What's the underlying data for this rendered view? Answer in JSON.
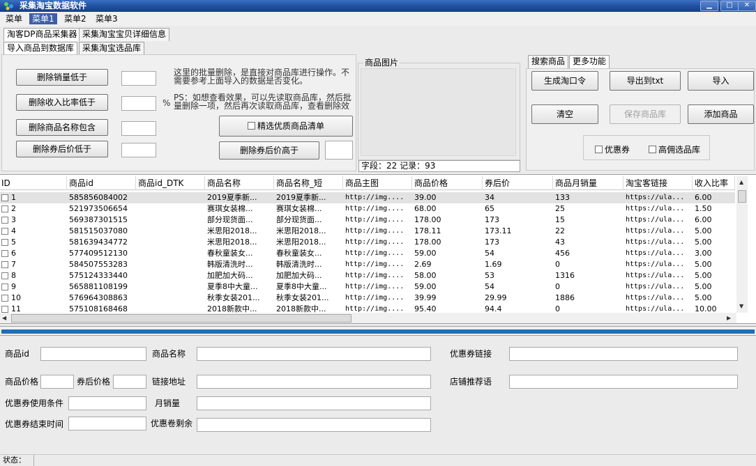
{
  "window": {
    "title": "采集淘宝数据软件"
  },
  "menubar": {
    "items": [
      "菜单",
      "菜单1",
      "菜单2",
      "菜单3"
    ],
    "active": "菜单1"
  },
  "tabs_row1": [
    "淘客DP商品采集器",
    "采集淘宝宝贝详细信息"
  ],
  "tabs_row2": [
    "导入商品到数据库",
    "采集淘宝选品库"
  ],
  "delete_panel": {
    "btn_sales_below": "删除销量低于",
    "btn_income_ratio_below": "删除收入比率低于",
    "percent_sign": "%",
    "btn_name_contains": "删除商品名称包含",
    "btn_coupon_price_below": "删除券后价低于",
    "btn_coupon_price_above": "删除券后价高于",
    "chk_quality_list": "精选优质商品清单",
    "note1": "这里的批量删除，是直接对商品库进行操作。不需要参考上面导入的数据是否变化。",
    "note2": "PS：如想查看效果，可以先读取商品库，然后批量删除一项，然后再次读取商品库，查看删除效果"
  },
  "image_group": {
    "title": "商品图片",
    "status": "字段：22 记录：93"
  },
  "right_panel": {
    "tabs": [
      "搜索商品",
      "更多功能"
    ],
    "btn_generate_token": "生成淘口令",
    "btn_export_txt": "导出到txt",
    "btn_import": "导入",
    "btn_clear": "清空",
    "btn_save": "保存商品库",
    "btn_add": "添加商品",
    "chk_coupon": "优惠券",
    "chk_high_commission": "高佣选品库"
  },
  "grid": {
    "columns": [
      "ID",
      "商品id",
      "商品id_DTK",
      "商品名称",
      "商品名称_短",
      "商品主图",
      "商品价格",
      "券后价",
      "商品月销量",
      "淘宝客链接",
      "收入比率"
    ],
    "rows": [
      [
        "1",
        "585856084002",
        "",
        "2019夏季新...",
        "2019夏季新...",
        "http://img....",
        "39.00",
        "34",
        "133",
        "https://ula...",
        "6.00"
      ],
      [
        "2",
        "521973506654",
        "",
        "赛琪女装棉...",
        "赛琪女装棉...",
        "http://img....",
        "68.00",
        "65",
        "25",
        "https://ula...",
        "1.50"
      ],
      [
        "3",
        "569387301515",
        "",
        "部分现货面...",
        "部分现货面...",
        "http://img....",
        "178.00",
        "173",
        "15",
        "https://ula...",
        "6.00"
      ],
      [
        "4",
        "581515037080",
        "",
        "米思阳2018...",
        "米思阳2018...",
        "http://img....",
        "178.11",
        "173.11",
        "22",
        "https://ula...",
        "5.00"
      ],
      [
        "5",
        "581639434772",
        "",
        "米思阳2018...",
        "米思阳2018...",
        "http://img....",
        "178.00",
        "173",
        "43",
        "https://ula...",
        "5.00"
      ],
      [
        "6",
        "577409512130",
        "",
        "春秋童装女...",
        "春秋童装女...",
        "http://img....",
        "59.00",
        "54",
        "456",
        "https://ula...",
        "3.00"
      ],
      [
        "7",
        "584507553283",
        "",
        "韩版清洗时...",
        "韩版清洗时...",
        "http://img....",
        "2.69",
        "1.69",
        "0",
        "https://ula...",
        "5.00"
      ],
      [
        "8",
        "575124333440",
        "",
        "加肥加大码...",
        "加肥加大码...",
        "http://img....",
        "58.00",
        "53",
        "1316",
        "https://ula...",
        "5.00"
      ],
      [
        "9",
        "565881108199",
        "",
        "夏季8中大童...",
        "夏季8中大童...",
        "http://img....",
        "59.00",
        "54",
        "0",
        "https://ula...",
        "5.00"
      ],
      [
        "10",
        "576964308863",
        "",
        "秋季女装201...",
        "秋季女装201...",
        "http://img....",
        "39.99",
        "29.99",
        "1886",
        "https://ula...",
        "5.00"
      ],
      [
        "11",
        "575108168468",
        "",
        "2018新款中...",
        "2018新款中...",
        "http://img....",
        "95.40",
        "94.4",
        "0",
        "https://ula...",
        "10.00"
      ]
    ]
  },
  "form": {
    "product_id": "商品id",
    "product_name": "商品名称",
    "coupon_link": "优惠券链接",
    "product_price": "商品价格",
    "coupon_price": "券后价格",
    "link_url": "链接地址",
    "shop_recommend": "店铺推荐语",
    "coupon_condition": "优惠券使用条件",
    "monthly_sales": "月销量",
    "coupon_end_time": "优惠券结束时间",
    "coupon_remaining": "优惠卷剩余"
  },
  "statusbar": {
    "label": "状态："
  }
}
